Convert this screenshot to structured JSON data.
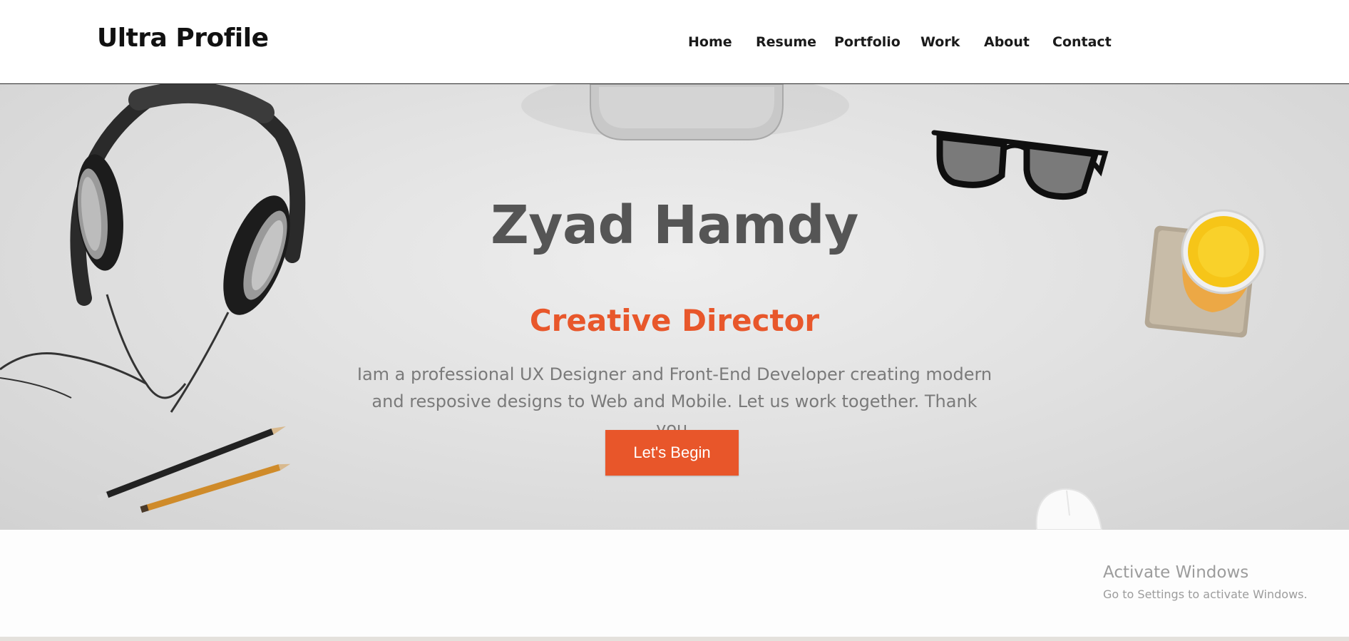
{
  "header": {
    "logo": "Ultra Profile",
    "nav": [
      {
        "label": "Home"
      },
      {
        "label": "Resume"
      },
      {
        "label": "Portfolio"
      },
      {
        "label": "Work"
      },
      {
        "label": "About"
      },
      {
        "label": "Contact"
      }
    ]
  },
  "hero": {
    "name": "Zyad Hamdy",
    "role": "Creative Director",
    "description": "Iam a professional UX Designer and Front-End Developer creating modern and resposive designs to Web and Mobile. Let us work together. Thank you.",
    "cta_label": "Let's Begin",
    "decorations": [
      "headphones",
      "pencils",
      "monitor-stand",
      "glasses",
      "juice-glass",
      "mouse"
    ]
  },
  "windows_watermark": {
    "title": "Activate Windows",
    "subtitle": "Go to Settings to activate Windows."
  },
  "colors": {
    "accent": "#e8562a",
    "name_text": "#555555",
    "body_text": "#7a7a7a"
  }
}
